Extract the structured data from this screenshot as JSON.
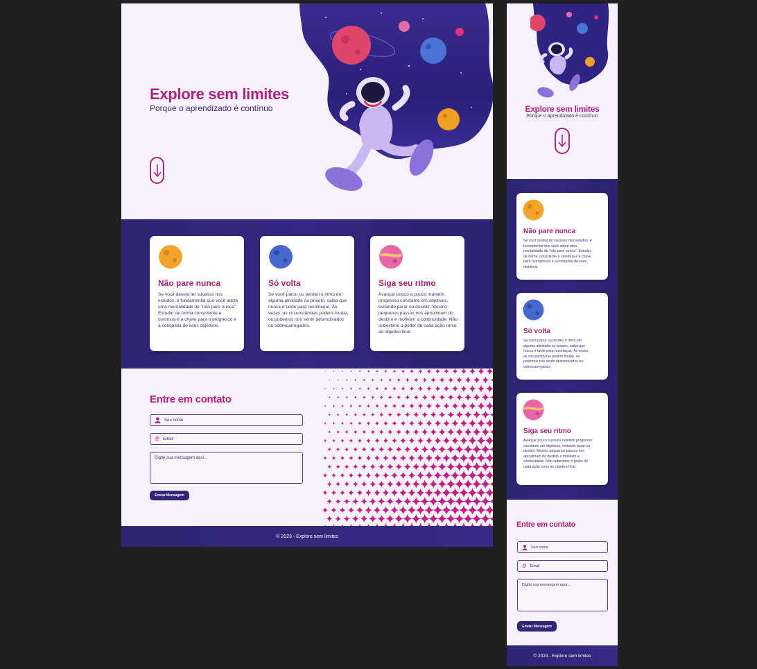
{
  "hero": {
    "title": "Explore sem limites",
    "subtitle": "Porque o aprendizado é contínuo"
  },
  "cards": [
    {
      "title": "Não pare nunca",
      "icon": "orange-planet-icon",
      "text": "Se você deseja ter sucesso nos estudos, é fundamental que você adote uma mentalidade de \"não pare nunca\". Estudar de forma consistente e contínua é a chave para o progresso e a conquista de seus objetivos."
    },
    {
      "title": "Só volta",
      "icon": "blue-planet-icon",
      "text": "Se você parou ou perdeu o ritmo em alguma atividade ou projeto, saiba que nunca é tarde para recomeçar. Às vezes, as circunstâncias podem mudar, ou podemos nos sentir desmotivados ou sobrecarregados."
    },
    {
      "title": "Siga seu ritmo",
      "icon": "pink-planet-icon",
      "text": "Avançar pouco a pouco mantém progresso constante em objetivos, evitando parar ou desistir. Mesmo pequenos passos nos aproximam do destino e motivam a continuidade. Não subestime o poder de cada ação rumo ao objetivo final."
    }
  ],
  "contact": {
    "title": "Entre em contato",
    "name_placeholder": "Seu nome",
    "email_placeholder": "Email",
    "message_placeholder": "Digite sua mensagem aqui...",
    "send_label": "Enviar Mensagem"
  },
  "footer": {
    "text": "© 2023 - Explore sem limites"
  },
  "colors": {
    "background": "#202020",
    "page": "#f7f1fb",
    "accent": "#b0207f",
    "band": "#2e2576"
  }
}
